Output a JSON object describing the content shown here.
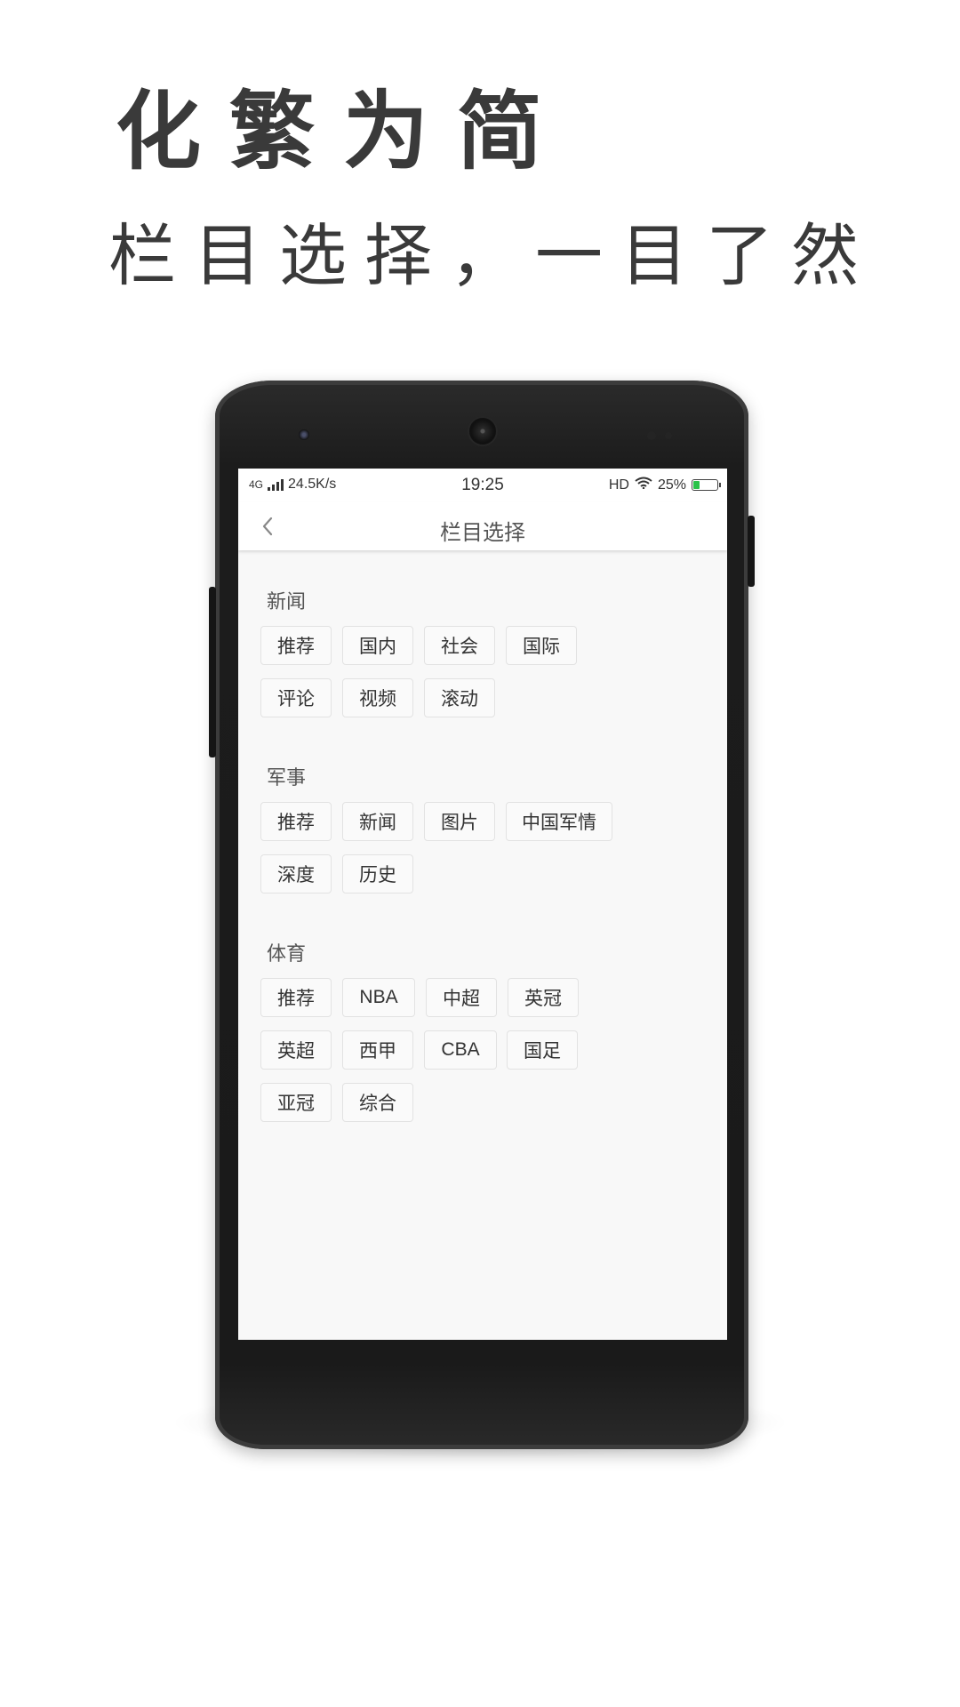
{
  "promo": {
    "title": "化繁为简",
    "subtitle": "栏目选择，一目了然"
  },
  "statusbar": {
    "network": "4G",
    "speed": "24.5K/s",
    "time": "19:25",
    "hd": "HD",
    "battery_text": "25%",
    "battery_level": 0.25,
    "wifi_icon": "wifi-icon",
    "signal_icon": "signal-bars-icon"
  },
  "navbar": {
    "back_icon": "chevron-left-icon",
    "title": "栏目选择"
  },
  "sections": [
    {
      "title": "新闻",
      "tags": [
        "推荐",
        "国内",
        "社会",
        "国际",
        "评论",
        "视频",
        "滚动"
      ]
    },
    {
      "title": "军事",
      "tags": [
        "推荐",
        "新闻",
        "图片",
        "中国军情",
        "深度",
        "历史"
      ]
    },
    {
      "title": "体育",
      "tags": [
        "推荐",
        "NBA",
        "中超",
        "英冠",
        "英超",
        "西甲",
        "CBA",
        "国足",
        "亚冠",
        "综合"
      ]
    }
  ],
  "colors": {
    "battery_fill": "#2bc24a",
    "tag_border": "#e2e2e2",
    "screen_bg": "#f8f8f8"
  }
}
